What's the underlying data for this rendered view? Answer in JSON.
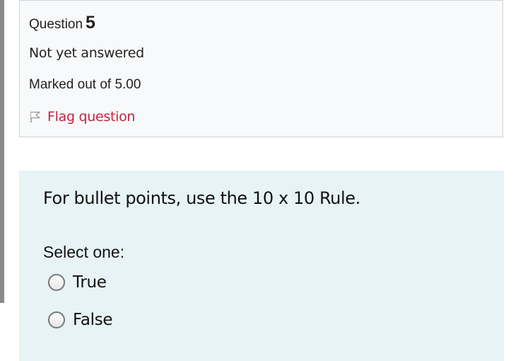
{
  "question": {
    "label": "Question",
    "number": "5",
    "state": "Not yet answered",
    "grade": "Marked out of 5.00",
    "flag_label": "Flag question"
  },
  "content": {
    "text": "For bullet points, use the 10 x 10 Rule.",
    "prompt": "Select one:",
    "options": [
      {
        "label": "True",
        "selected": false
      },
      {
        "label": "False",
        "selected": false
      }
    ]
  },
  "colors": {
    "flag": "#c6233f",
    "content_bg": "#e7f3f5",
    "info_bg": "#f8f9fa"
  },
  "icons": {
    "flag": "flag-icon",
    "radio": "radio-empty-icon"
  }
}
